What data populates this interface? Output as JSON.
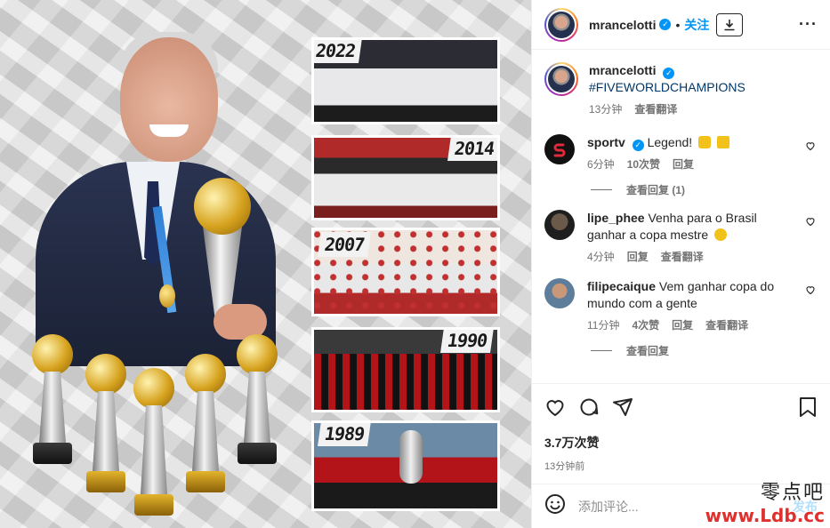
{
  "post": {
    "username": "mrancelotti",
    "follow_label": "关注",
    "separator": "•",
    "more_label": "···",
    "caption": {
      "username": "mrancelotti",
      "hashtag": "#FIVEWORLDCHAMPIONS",
      "time": "13分钟",
      "translate": "查看翻译"
    },
    "image": {
      "years": [
        "2022",
        "2014",
        "2007",
        "1990",
        "1989"
      ]
    }
  },
  "comments": [
    {
      "username": "sportv",
      "verified": true,
      "text": "Legend!",
      "time": "6分钟",
      "likes": "10次赞",
      "reply": "回复",
      "view_replies": "查看回复 (1)"
    },
    {
      "username": "lipe_phee",
      "verified": false,
      "text": "Venha para o Brasil ganhar a copa mestre",
      "time": "4分钟",
      "reply": "回复",
      "translate": "查看翻译"
    },
    {
      "username": "filipecaique",
      "verified": false,
      "text": "Vem ganhar copa do mundo com a gente",
      "time": "11分钟",
      "likes": "4次赞",
      "reply": "回复",
      "translate": "查看翻译"
    }
  ],
  "truncated_text": "查看回复",
  "actions": {
    "likes": "3.7万次赞",
    "time": "13分钟前"
  },
  "composer": {
    "placeholder": "添加评论...",
    "post_label": "发布"
  },
  "watermark": {
    "line1": "零点吧",
    "line2": "www.Ldb.cc"
  },
  "colors": {
    "accent": "#0095f6",
    "text": "#262626",
    "muted": "#737373"
  },
  "icons": [
    "verified-icon",
    "download-icon",
    "more-icon",
    "heart-icon",
    "comment-icon",
    "share-icon",
    "save-icon",
    "emoji-icon",
    "trophy-emoji",
    "crown-emoji",
    "praying-hands-emoji"
  ]
}
